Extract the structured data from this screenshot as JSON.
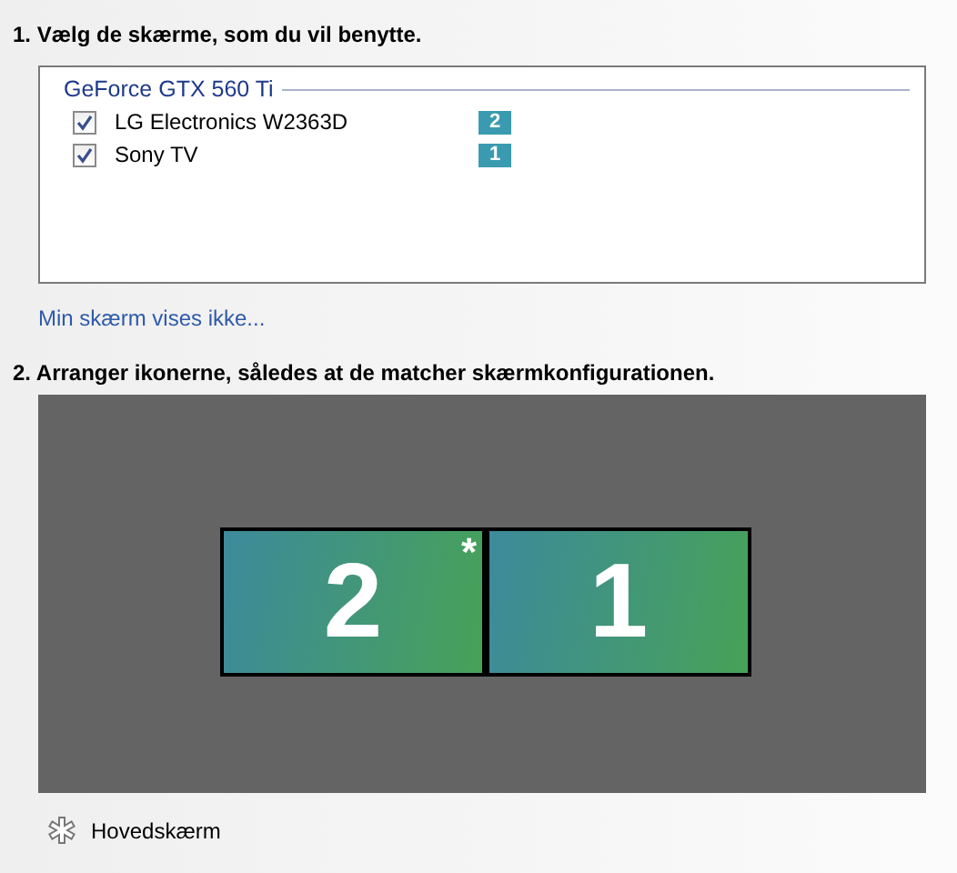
{
  "step1": {
    "heading": "1. Vælg de skærme, som du vil benytte.",
    "group": "GeForce GTX 560 Ti",
    "displays": [
      {
        "name": "LG Electronics W2363D",
        "checked": true,
        "badge": "2"
      },
      {
        "name": "Sony TV",
        "checked": true,
        "badge": "1"
      }
    ],
    "link": "Min skærm vises ikke..."
  },
  "step2": {
    "heading": "2. Arranger ikonerne, således at de matcher skærmkonfigurationen.",
    "primary_mark": "*",
    "monitors": [
      {
        "label": "2",
        "primary": true
      },
      {
        "label": "1",
        "primary": false
      }
    ]
  },
  "legend": {
    "label": "Hovedskærm"
  }
}
